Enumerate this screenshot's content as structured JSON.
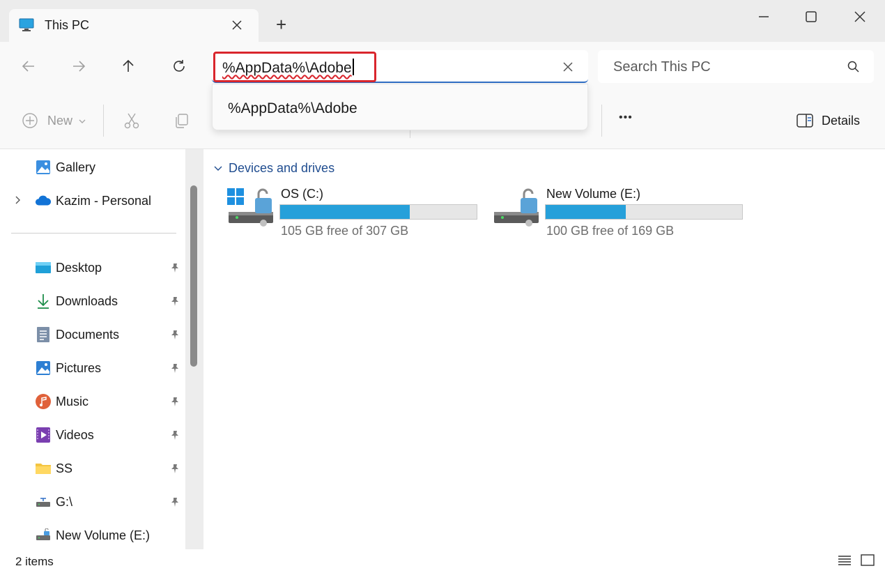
{
  "window": {
    "tab_title": "This PC",
    "new_tab_glyph": "+"
  },
  "navigation": {
    "address_value": "%AppData%\\Adobe",
    "search_placeholder": "Search This PC"
  },
  "suggestion": {
    "text": "%AppData%\\Adobe"
  },
  "toolbar": {
    "new_label": "New",
    "more_glyph": "•••",
    "details_label": "Details"
  },
  "sidebar": {
    "top_items": [
      {
        "label": "Gallery",
        "icon": "gallery-icon"
      },
      {
        "label": "Kazim - Personal",
        "icon": "onedrive-icon"
      }
    ],
    "quick_access": [
      {
        "label": "Desktop",
        "icon": "desktop-icon"
      },
      {
        "label": "Downloads",
        "icon": "downloads-icon"
      },
      {
        "label": "Documents",
        "icon": "documents-icon"
      },
      {
        "label": "Pictures",
        "icon": "pictures-icon"
      },
      {
        "label": "Music",
        "icon": "music-icon"
      },
      {
        "label": "Videos",
        "icon": "videos-icon"
      },
      {
        "label": "SS",
        "icon": "folder-icon"
      },
      {
        "label": "G:\\",
        "icon": "network-drive-icon"
      },
      {
        "label": "New Volume (E:)",
        "icon": "drive-icon"
      }
    ]
  },
  "content": {
    "group_label": "Devices and drives",
    "drives": [
      {
        "name": "OS (C:)",
        "free_text": "105 GB free of 307 GB",
        "used_fraction": 0.658
      },
      {
        "name": "New Volume (E:)",
        "free_text": "100 GB free of 169 GB",
        "used_fraction": 0.408
      }
    ]
  },
  "status": {
    "items_text": "2 items"
  },
  "colors": {
    "accent": "#2f6ec5",
    "highlight_border": "#d9262d",
    "drive_bar": "#26a0da"
  }
}
